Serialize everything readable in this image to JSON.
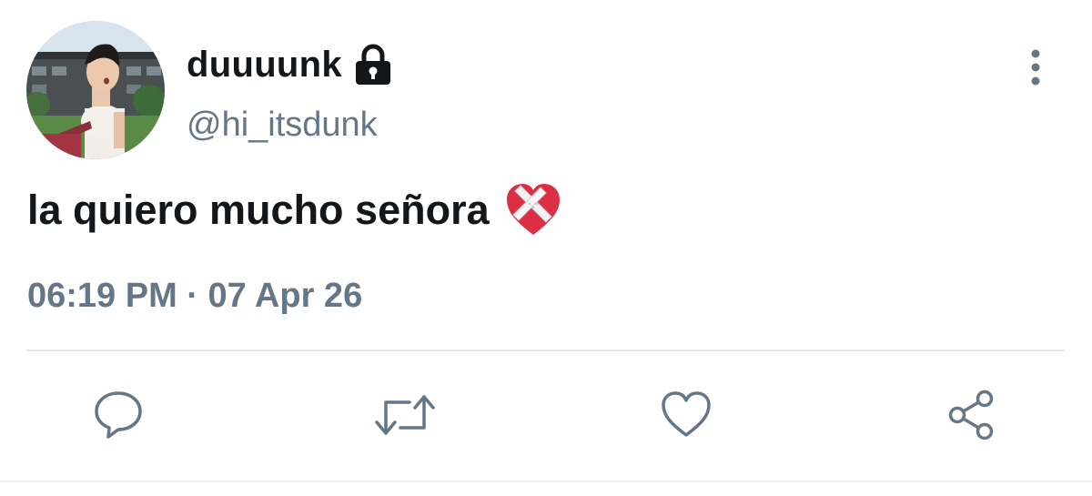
{
  "tweet": {
    "display_name": "duuuunk",
    "handle": "@hi_itsdunk",
    "text": "la quiero mucho señora",
    "emoji": "mending-heart",
    "timestamp": "06:19 PM · 07 Apr 26",
    "protected_account": true
  },
  "icons": {
    "lock": "lock-icon",
    "more": "more-vertical-icon",
    "reply": "reply-icon",
    "retweet": "retweet-icon",
    "like": "heart-icon",
    "share": "share-icon"
  },
  "colors": {
    "primary_text": "#14171a",
    "secondary_text": "#657786",
    "divider": "#e1e8ed"
  }
}
